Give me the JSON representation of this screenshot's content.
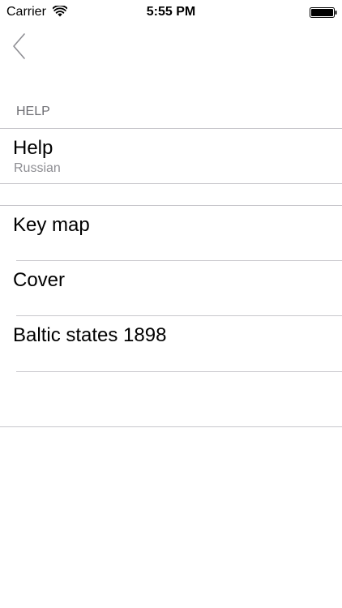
{
  "status_bar": {
    "carrier": "Carrier",
    "time": "5:55 PM",
    "icons": [
      "wifi-icon",
      "battery-icon"
    ]
  },
  "nav": {
    "back_icon": "chevron-left-icon"
  },
  "section": {
    "header": "HELP",
    "rows": [
      {
        "title": "Help",
        "subtitle": "Russian"
      }
    ]
  },
  "list": {
    "rows": [
      {
        "title": "Key map"
      },
      {
        "title": "Cover"
      },
      {
        "title": "Baltic states 1898"
      }
    ]
  },
  "colors": {
    "separator": "#c8c7cc",
    "secondary_text": "#8e8e93",
    "header_text": "#6d6d72",
    "accent": "#007aff"
  }
}
